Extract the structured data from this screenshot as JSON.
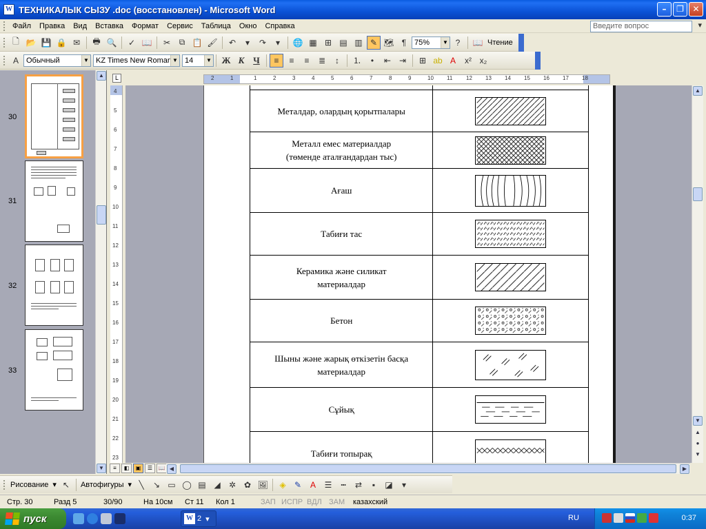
{
  "window": {
    "title": "ТЕХНИКАЛЫК СЫЗУ .doc (восстановлен) - Microsoft Word"
  },
  "menu": {
    "items": [
      "Файл",
      "Правка",
      "Вид",
      "Вставка",
      "Формат",
      "Сервис",
      "Таблица",
      "Окно",
      "Справка"
    ],
    "help_placeholder": "Введите вопрос"
  },
  "toolbar_standard": {
    "zoom": "75%",
    "reading_label": "Чтение"
  },
  "toolbar_format": {
    "style": "Обычный",
    "font": "KZ Times New Roman",
    "size": "14",
    "bold": "Ж",
    "italic": "К",
    "underline": "Ч"
  },
  "thumbnails": {
    "pages": [
      "30",
      "31",
      "32",
      "33"
    ],
    "selected": "30"
  },
  "ruler": {
    "horizontal": [
      "2",
      "1",
      "1",
      "2",
      "3",
      "4",
      "5",
      "6",
      "7",
      "8",
      "9",
      "10",
      "11",
      "12",
      "13",
      "14",
      "15",
      "16",
      "17",
      "18"
    ],
    "vertical": [
      "4",
      "5",
      "6",
      "7",
      "8",
      "9",
      "10",
      "11",
      "12",
      "13",
      "14",
      "15",
      "16",
      "17",
      "18",
      "19",
      "20",
      "21",
      "22",
      "23"
    ]
  },
  "table": {
    "rows": [
      {
        "label": "Металдар, олардың қорытпалары",
        "pattern": "diagonal"
      },
      {
        "label": "Металл емес материалдар\n(төменде аталғандардан тыс)",
        "pattern": "crosshatch"
      },
      {
        "label": "Ағаш",
        "pattern": "wood"
      },
      {
        "label": "Табиғи тас",
        "pattern": "stone"
      },
      {
        "label": "Керамика және силикат\nматериалдар",
        "pattern": "diagonal-wide"
      },
      {
        "label": "Бетон",
        "pattern": "concrete"
      },
      {
        "label": "Шыны және жарық өткізетін басқа\nматериалдар",
        "pattern": "glass"
      },
      {
        "label": "Сұйық",
        "pattern": "liquid"
      },
      {
        "label": "Табиғи топырақ",
        "pattern": "soil"
      }
    ]
  },
  "drawing_toolbar": {
    "draw_label": "Рисование",
    "autoshapes_label": "Автофигуры"
  },
  "status": {
    "page": "Стр. 30",
    "section": "Разд 5",
    "pages": "30/90",
    "at": "На 10см",
    "line": "Ст 11",
    "col": "Кол 1",
    "rec": "ЗАП",
    "trk": "ИСПР",
    "ext": "ВДЛ",
    "ovr": "ЗАМ",
    "language": "казахский"
  },
  "taskbar": {
    "start_label": "пуск",
    "word_button": "2",
    "lang": "RU",
    "clock": "0:37"
  },
  "colors": {
    "title_bar": "#0b52d6",
    "page_background": "#a6a8b5",
    "selected_thumb_border": "#f7a043",
    "start_button": "#3c8a32"
  }
}
